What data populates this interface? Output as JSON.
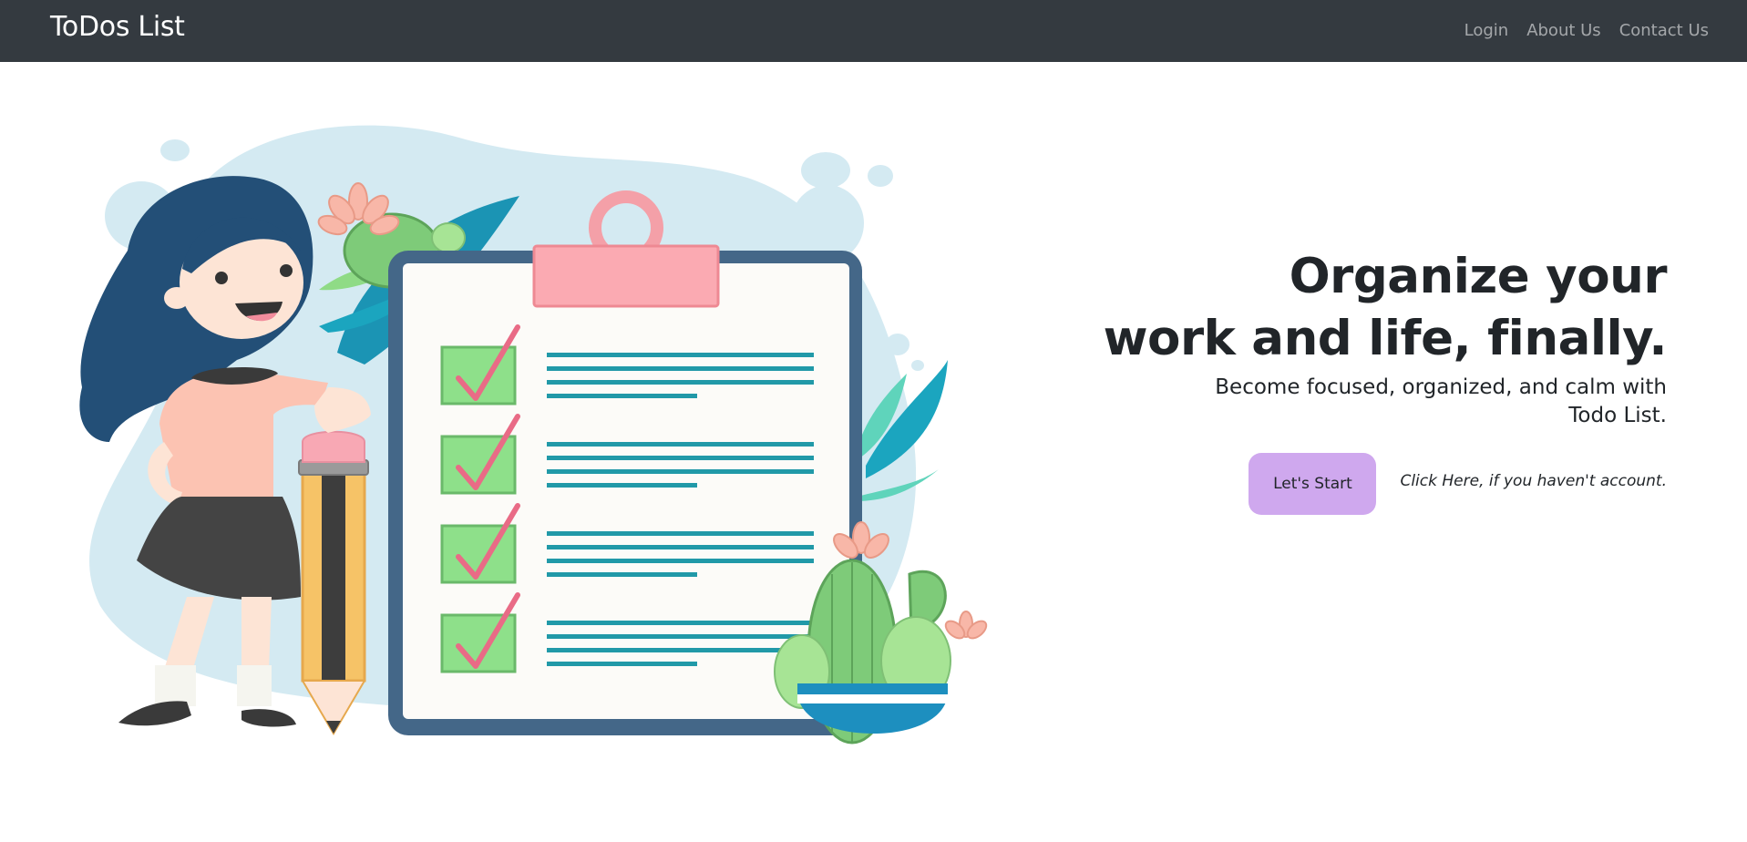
{
  "navbar": {
    "brand": "ToDos List",
    "links": [
      "Login",
      "About Us",
      "Contact Us"
    ]
  },
  "hero": {
    "headline_line1": "Organize your",
    "headline_line2": "work and life, finally.",
    "subtitle_line1": "Become focused, organized, and calm with",
    "subtitle_line2": "Todo List.",
    "cta_label": "Let's Start",
    "cta_hint": "Click Here, if you haven't account."
  },
  "colors": {
    "navbar_bg": "#343a40",
    "cta_bg": "#cfa8ee",
    "illustration_blob": "#d4eaf2",
    "checkbox_green": "#8ee08a",
    "check_pink": "#e96b86",
    "list_line_teal": "#2199a8",
    "clipboard_frame": "#446788"
  }
}
